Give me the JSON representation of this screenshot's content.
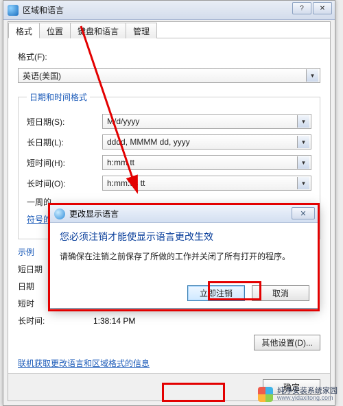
{
  "window": {
    "title": "区域和语言",
    "min_icon_name": "minimize-icon",
    "close_icon_name": "close-icon"
  },
  "tabs": [
    {
      "label": "格式",
      "active": true
    },
    {
      "label": "位置",
      "active": false
    },
    {
      "label": "键盘和语言",
      "active": false
    },
    {
      "label": "管理",
      "active": false
    }
  ],
  "format": {
    "label": "格式(F):",
    "value": "英语(美国)"
  },
  "datetime_group": {
    "legend": "日期和时间格式",
    "short_date_label": "短日期(S):",
    "short_date_value": "M/d/yyyy",
    "long_date_label": "长日期(L):",
    "long_date_value": "dddd, MMMM dd, yyyy",
    "short_time_label": "短时间(H):",
    "short_time_value": "h:mm tt",
    "long_time_label": "长时间(O):",
    "long_time_value": "h:mm:ss tt",
    "first_day_label": "一周的"
  },
  "notation_link": "符号的",
  "example": {
    "title": "示例",
    "short_date_label": "短日期",
    "long_date_label": "日期",
    "short_time_label": "短时",
    "long_time_label": "长时间:",
    "long_time_value": "1:38:14 PM"
  },
  "other_settings_btn": "其他设置(D)...",
  "bottom_link": "联机获取更改语言和区域格式的信息",
  "ok_btn": "确定",
  "dialog": {
    "title": "更改显示语言",
    "heading": "您必须注销才能使显示语言更改生效",
    "message": "请确保在注销之前保存了所做的工作并关闭了所有打开的程序。",
    "logoff_btn": "立即注销",
    "cancel_btn": "取消"
  },
  "watermark": {
    "name": "纯净安装系统家园",
    "url": "www.yidaxitong.com"
  }
}
